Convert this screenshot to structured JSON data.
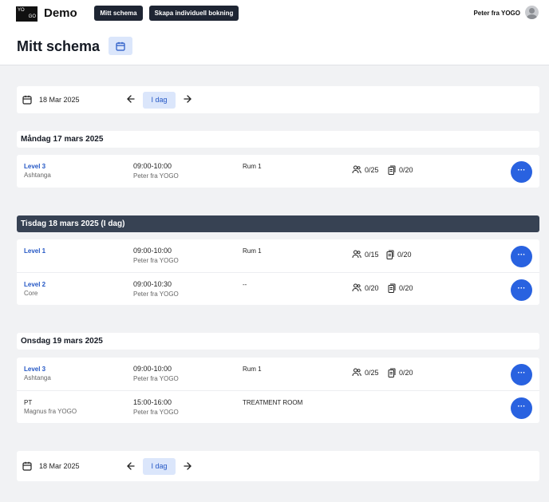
{
  "app": {
    "logo_line1": "YO",
    "logo_line2": "GO",
    "brand": "Demo"
  },
  "nav": {
    "my_schedule": "Mitt schema",
    "create_booking": "Skapa individuell bokning"
  },
  "user": {
    "name": "Peter fra YOGO"
  },
  "page": {
    "title": "Mitt schema"
  },
  "datebar": {
    "date": "18 Mar 2025",
    "today_label": "I dag"
  },
  "days": [
    {
      "title": "Måndag 17 mars 2025",
      "is_today": false,
      "classes": [
        {
          "name": "Level 3",
          "type": "Ashtanga",
          "time": "09:00-10:00",
          "teacher": "Peter fra YOGO",
          "room": "Rum 1",
          "signups": "0/25",
          "waitlist": "0/20"
        }
      ]
    },
    {
      "title": "Tisdag 18 mars 2025 (I dag)",
      "is_today": true,
      "classes": [
        {
          "name": "Level 1",
          "type": "",
          "time": "09:00-10:00",
          "teacher": "Peter fra YOGO",
          "room": "Rum 1",
          "signups": "0/15",
          "waitlist": "0/20"
        },
        {
          "name": "Level 2",
          "type": "Core",
          "time": "09:00-10:30",
          "teacher": "Peter fra YOGO",
          "room": "--",
          "signups": "0/20",
          "waitlist": "0/20"
        }
      ]
    },
    {
      "title": "Onsdag 19 mars 2025",
      "is_today": false,
      "classes": [
        {
          "name": "Level 3",
          "type": "Ashtanga",
          "time": "09:00-10:00",
          "teacher": "Peter fra YOGO",
          "room": "Rum 1",
          "signups": "0/25",
          "waitlist": "0/20"
        },
        {
          "name": "PT",
          "type": "Magnus fra YOGO",
          "time": "15:00-16:00",
          "teacher": "Peter fra YOGO",
          "room": "TREATMENT ROOM",
          "signups": "",
          "waitlist": ""
        }
      ]
    }
  ],
  "more_button_label": "···",
  "colors": {
    "accent": "#2962e0",
    "nav_dark": "#1e2533",
    "today_header": "#374253",
    "light_button": "#dbe6fb"
  },
  "icons": {
    "calendar": "calendar-icon",
    "prev": "arrow-left-icon",
    "next": "arrow-right-icon",
    "people": "users-icon",
    "copy": "clipboard-icon",
    "more": "more-dots-icon"
  }
}
